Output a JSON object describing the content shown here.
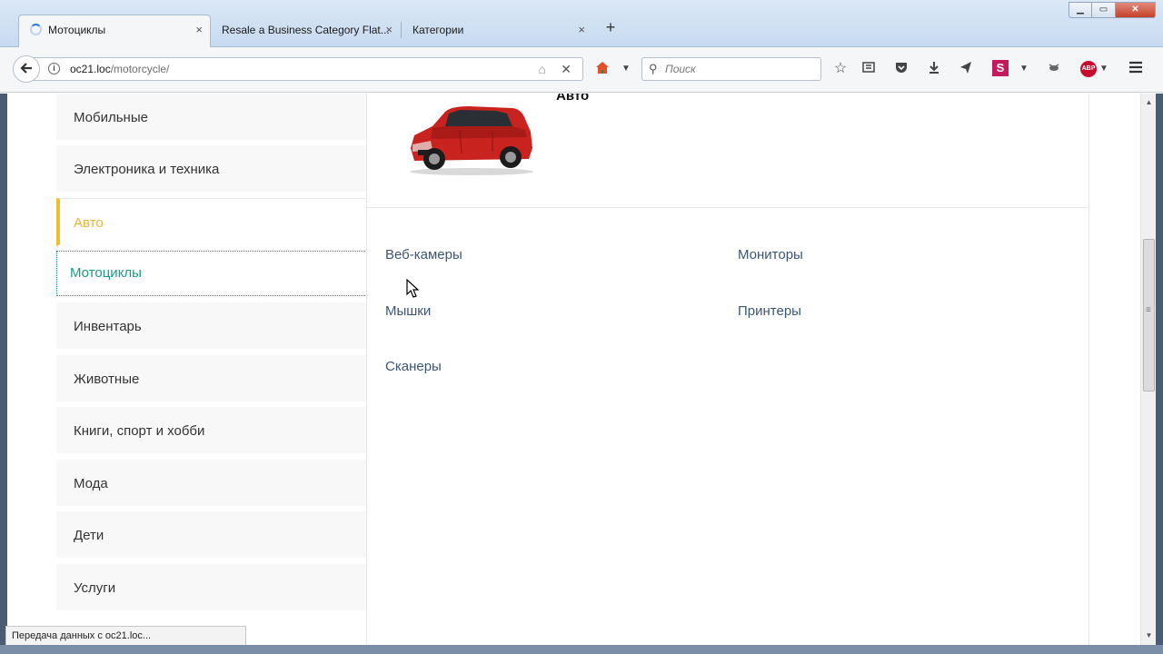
{
  "browser": {
    "tabs": [
      {
        "label": "Мотоциклы",
        "loading": true
      },
      {
        "label": "Resale a Business Category Flat..."
      },
      {
        "label": "Категории"
      }
    ],
    "new_tab_symbol": "+",
    "window_buttons": {
      "minimize": "▁",
      "maximize": "▭",
      "close": "✕"
    },
    "url_host": "oc21.loc",
    "url_path": "/motorcycle/",
    "search_placeholder": "Поиск",
    "tab_close_symbol": "×"
  },
  "page": {
    "featured": {
      "title": "Авто"
    },
    "categories": [
      {
        "label": "Мобильные",
        "state": "normal"
      },
      {
        "label": "Электроника и техника",
        "state": "normal"
      },
      {
        "label": "Авто",
        "state": "active"
      },
      {
        "label": "Мотоциклы",
        "state": "hover"
      },
      {
        "label": "Инвентарь",
        "state": "normal"
      },
      {
        "label": "Животные",
        "state": "normal"
      },
      {
        "label": "Книги, спорт и хобби",
        "state": "normal"
      },
      {
        "label": "Мода",
        "state": "normal"
      },
      {
        "label": "Дети",
        "state": "normal"
      },
      {
        "label": "Услуги",
        "state": "normal"
      }
    ],
    "subcategories": [
      {
        "label": "Веб-камеры"
      },
      {
        "label": "Мониторы"
      },
      {
        "label": "Мышки"
      },
      {
        "label": "Принтеры"
      },
      {
        "label": "Сканеры"
      }
    ]
  },
  "status": {
    "text": "Передача данных с oc21.loc..."
  },
  "colors": {
    "active_accent": "#f0be2a",
    "hover_text": "#1a9b8a",
    "link": "#3b5674"
  }
}
